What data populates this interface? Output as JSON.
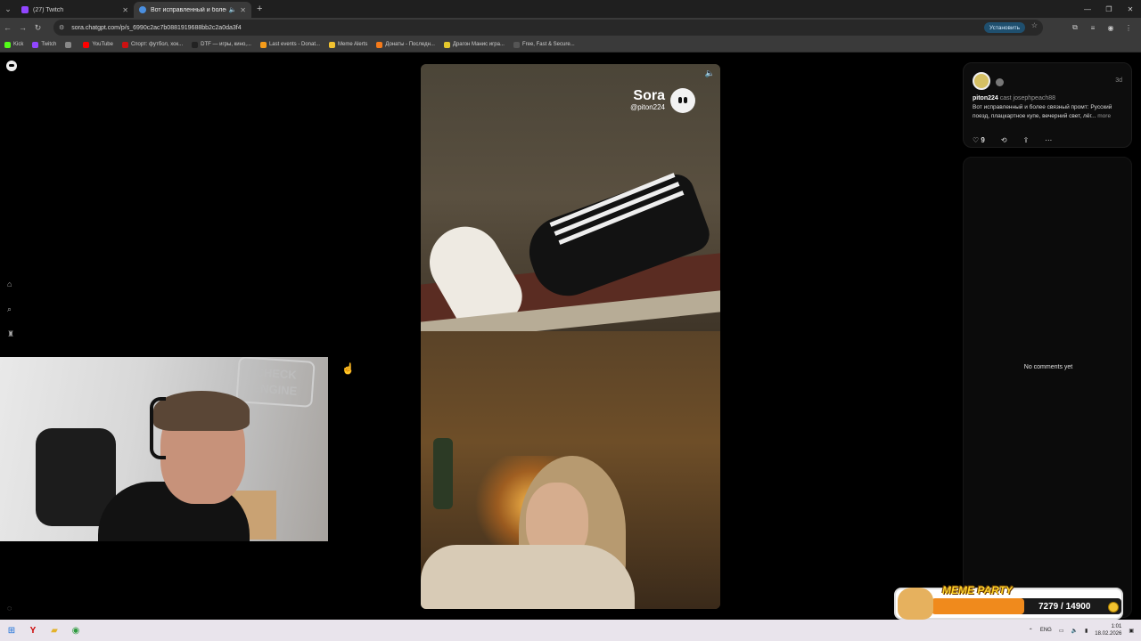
{
  "browser": {
    "tabs": [
      {
        "title": "(27) Twitch",
        "color": "#9146ff"
      },
      {
        "title": "Вот исправленный и более",
        "color": "#4a8fe0"
      }
    ],
    "url": "sora.chatgpt.com/p/s_6990c2ac7b0881919688bb2c2a0da3f4",
    "install_label": "Установить",
    "bookmarks": [
      {
        "label": "Kick",
        "color": "#53fc18"
      },
      {
        "label": "Twitch",
        "color": "#9146ff"
      },
      {
        "label": "",
        "color": "#888888"
      },
      {
        "label": "YouTube",
        "color": "#ff0000"
      },
      {
        "label": "Спорт: футбол, хок...",
        "color": "#c11"
      },
      {
        "label": "DTF — игры, кино,...",
        "color": "#222"
      },
      {
        "label": "Last events - Donat...",
        "color": "#f59c1a"
      },
      {
        "label": "Meme Alerts",
        "color": "#f2c230"
      },
      {
        "label": "Донаты - Последн...",
        "color": "#f57a1a"
      },
      {
        "label": "Драгон Манис игра...",
        "color": "#e4c72c"
      },
      {
        "label": "Free, Fast & Secure...",
        "color": "#555"
      }
    ]
  },
  "video": {
    "brand": "Sora",
    "handle": "@piton224"
  },
  "post": {
    "age": "3d",
    "username": "piton224",
    "cast_text": "cast josephpeach88",
    "description": "Вот исправленный и более связный промт: Русский поезд, плацкартное купе, вечерний свет, лёг...",
    "more_label": "more",
    "likes": "9"
  },
  "comments": {
    "empty_label": "No comments yet"
  },
  "meme_party": {
    "title": "MEME PARTY",
    "current": 7279,
    "goal": 14900,
    "count_label": "7279 / 14900"
  },
  "taskbar": {
    "lang": "ENG",
    "time": "1:01",
    "date": "18.02.2026"
  }
}
